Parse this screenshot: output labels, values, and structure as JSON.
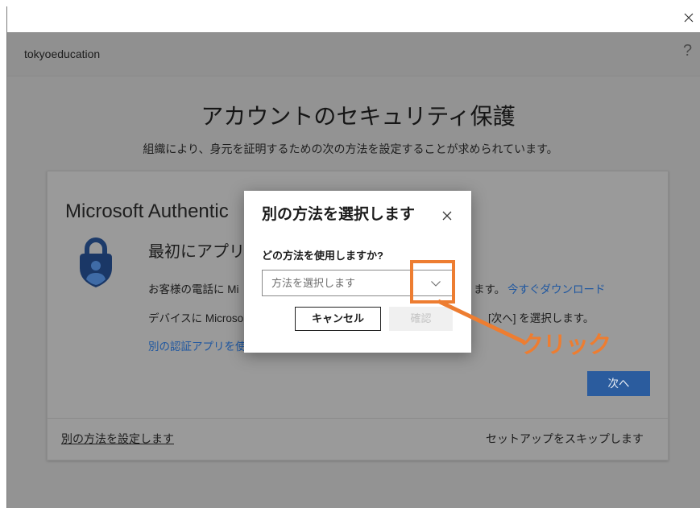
{
  "titlebar": {
    "close_icon": "close-icon"
  },
  "header": {
    "org_name": "tokyoeducation",
    "help_label": "?"
  },
  "page": {
    "title": "アカウントのセキュリティ保護",
    "subtitle": "組織により、身元を証明するための次の方法を設定することが求められています。"
  },
  "card": {
    "method_title": "Microsoft Authentic",
    "app_icon": "authenticator-app-icon",
    "step_heading": "最初にアプリ",
    "install_text": "お客様の電話に Mi",
    "install_text_end": "ます。",
    "download_link": "今すぐダウンロード",
    "device_text": "デバイスに Microso",
    "device_text_end": "[次へ] を選択します。",
    "other_app_link": "別の認証アプリを使",
    "next_button": "次へ",
    "footer": {
      "other_method_link": "別の方法を設定します",
      "skip_link": "セットアップをスキップします"
    }
  },
  "dialog": {
    "title": "別の方法を選択します",
    "close_icon": "close-icon",
    "question": "どの方法を使用しますか?",
    "method_select": {
      "placeholder": "方法を選択します",
      "chevron_icon": "chevron-down-icon"
    },
    "cancel_button": "キャンセル",
    "confirm_button": "確認",
    "confirm_enabled": false
  },
  "annotation": {
    "label": "クリック"
  },
  "colors": {
    "annotation": "#ED7D31",
    "link": "#1f57a0",
    "primary_button": "#2b5c9e",
    "dimmed_page": "#939393"
  }
}
